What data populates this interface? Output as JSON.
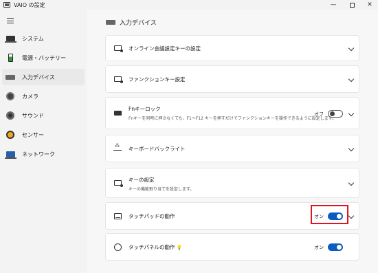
{
  "window": {
    "title": "VAIO の設定",
    "min": "—",
    "close": "✕"
  },
  "sidebar": {
    "items": [
      {
        "label": "システム",
        "icon": "laptop-icon"
      },
      {
        "label": "電源・バッテリー",
        "icon": "battery-icon"
      },
      {
        "label": "入力デバイス",
        "icon": "keyboard-icon",
        "active": true
      },
      {
        "label": "カメラ",
        "icon": "camera-icon"
      },
      {
        "label": "サウンド",
        "icon": "speaker-icon"
      },
      {
        "label": "センサー",
        "icon": "sensor-icon"
      },
      {
        "label": "ネットワーク",
        "icon": "network-icon"
      }
    ]
  },
  "page": {
    "title": "入力デバイス"
  },
  "cards": [
    {
      "label": "オンライン会議設定キーの設定"
    },
    {
      "label": "ファンクションキー設定"
    },
    {
      "label": "Fnキーロック",
      "desc": "Fnキーを同時に押さなくても、F1～F12 キーを押すだけでファンクションキーを操作できるように設定します。",
      "toggle_label": "オフ",
      "toggle_on": false
    },
    {
      "label": "キーボードバックライト"
    },
    {
      "label": "キーの設定",
      "desc": "キーの機能割り当てを設定します。"
    },
    {
      "label": "タッチパッドの動作",
      "toggle_label": "オン",
      "toggle_on": true
    },
    {
      "label": "タッチパネルの動作",
      "toggle_label": "オン",
      "toggle_on": true
    }
  ],
  "colors": {
    "accent": "#0a5cc2",
    "highlight": "#e0141e"
  }
}
